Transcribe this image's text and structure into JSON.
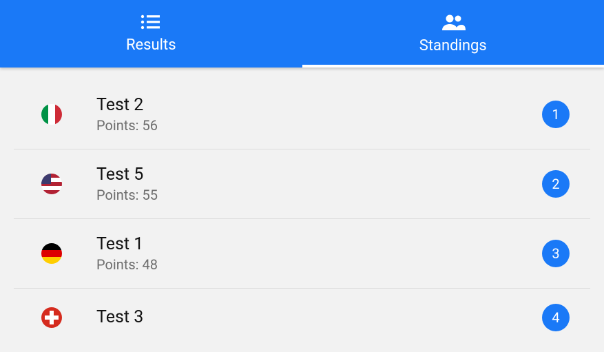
{
  "tabs": {
    "results": {
      "label": "Results"
    },
    "standings": {
      "label": "Standings"
    }
  },
  "points_prefix": "Points: ",
  "standings": [
    {
      "name": "Test 2",
      "points": "56",
      "rank": "1",
      "flag": "italy"
    },
    {
      "name": "Test 5",
      "points": "55",
      "rank": "2",
      "flag": "usa"
    },
    {
      "name": "Test 1",
      "points": "48",
      "rank": "3",
      "flag": "germany"
    },
    {
      "name": "Test 3",
      "points": "",
      "rank": "4",
      "flag": "swiss"
    }
  ]
}
